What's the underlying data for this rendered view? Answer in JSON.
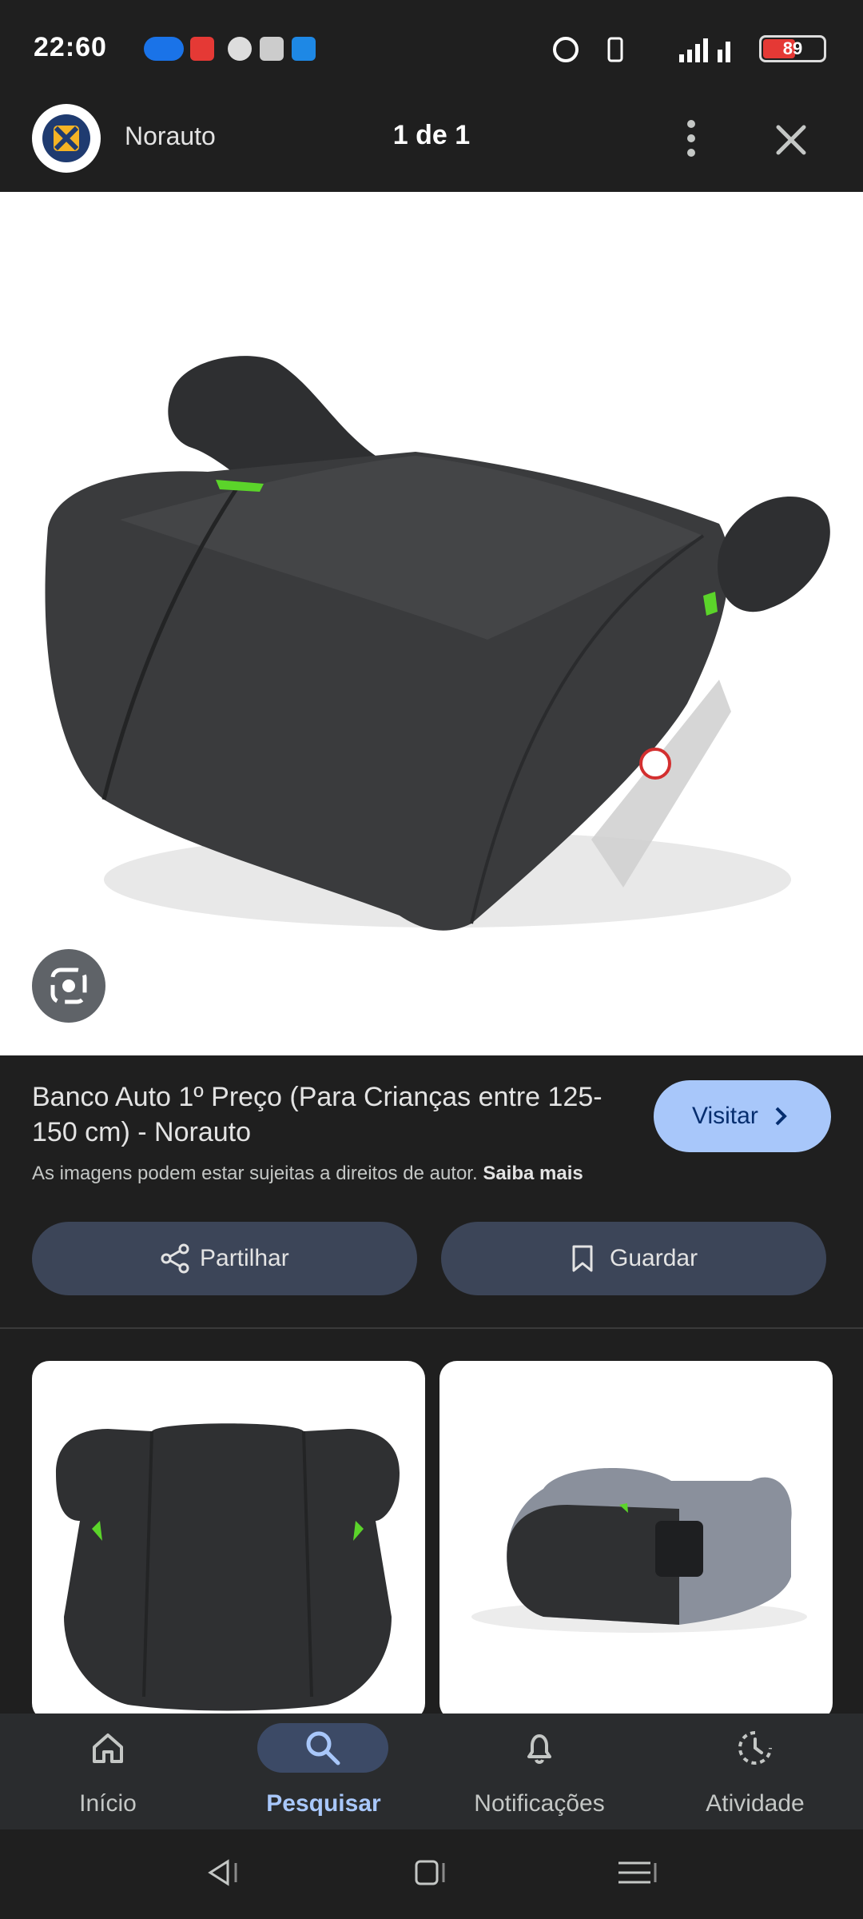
{
  "status_bar": {
    "time": "22:60",
    "battery": "89"
  },
  "header": {
    "source_name": "Norauto",
    "counter": "1 de 1",
    "more_icon": "more-vert-icon",
    "close_icon": "close-icon"
  },
  "viewer": {
    "image": "booster-seat-photo",
    "lens_icon": "google-lens-icon"
  },
  "result": {
    "title": "Banco Auto 1º Preço (Para Crianças entre 125-150 cm) - Norauto",
    "visit_label": "Visitar",
    "copyright_text": "As imagens podem estar sujeitas a direitos de autor.",
    "learn_more": "Saiba mais"
  },
  "actions": {
    "share_label": "Partilhar",
    "save_label": "Guardar"
  },
  "related": [
    {
      "image": "booster-seat-front-photo"
    },
    {
      "image": "booster-seat-grey-cupholder-photo"
    }
  ],
  "bottom_nav": [
    {
      "label": "Início",
      "icon": "home-icon"
    },
    {
      "label": "Pesquisar",
      "icon": "search-icon",
      "active": true
    },
    {
      "label": "Notificações",
      "icon": "bell-icon"
    },
    {
      "label": "Atividade",
      "icon": "activity-icon"
    }
  ],
  "colors": {
    "accent": "#a8c7fa",
    "surface": "#1f1f1f",
    "pill": "#3c4558"
  }
}
